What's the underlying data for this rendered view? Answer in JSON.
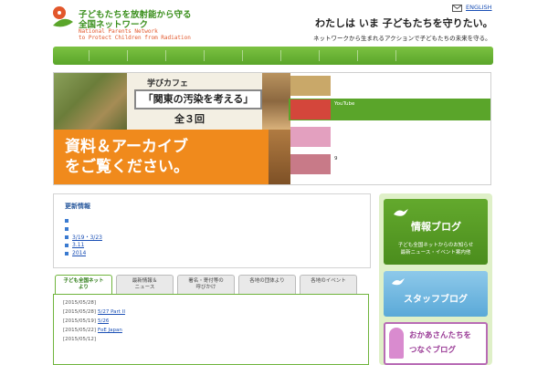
{
  "header": {
    "logo_line1": "子どもたちを放射能から守る",
    "logo_line2": "全国ネットワーク",
    "logo_en1": "National Parents Network",
    "logo_en2": "to Protect Children from Radiation",
    "english_link": "ENGLISH",
    "tagline": "わたしは いま 子どもたちを守りたい。",
    "subtagline": "ネットワークから生まれるアクションで子どもたちの未来を守る。"
  },
  "nav": {
    "items": [
      "",
      "",
      "",
      "",
      "",
      "",
      "",
      "",
      ""
    ]
  },
  "banner": {
    "cafe_title": "学びカフェ",
    "cafe_main": "「関東の汚染を考える」",
    "cafe_round": "全３回",
    "orange_line1": "資料＆アーカイブ",
    "orange_line2": "をご覧ください。",
    "list": [
      {
        "text": "",
        "active": false,
        "thumb": "#c9a869"
      },
      {
        "text": "YouTube",
        "active": true,
        "thumb": "#d4463b"
      },
      {
        "text": "",
        "active": false,
        "thumb": "#e3a0bf"
      },
      {
        "text": "9",
        "active": false,
        "thumb": "#c87a88"
      }
    ]
  },
  "news": {
    "title": "更新情報",
    "items": [
      "",
      "",
      "3/19・3/23",
      "3.11",
      "2014"
    ]
  },
  "tabs": {
    "items": [
      {
        "label": "子ども全国ネット\nより",
        "active": true
      },
      {
        "label": "最新情報＆\nニュース",
        "active": false
      },
      {
        "label": "署名・寄付等の\n呼びかけ",
        "active": false
      },
      {
        "label": "各地の団体より",
        "active": false
      },
      {
        "label": "各地のイベント",
        "active": false
      }
    ],
    "rows": [
      {
        "date": "[2015/05/28]",
        "text": ""
      },
      {
        "date": "[2015/05/28]",
        "text": "5/27 Part II"
      },
      {
        "date": "[2015/05/19]",
        "text": "5/26"
      },
      {
        "date": "[2015/05/22]",
        "text": "FoE Japan"
      },
      {
        "date": "[2015/05/12]",
        "text": ""
      }
    ]
  },
  "sidebar": {
    "info_title": "情報ブログ",
    "info_sub1": "子ども全国ネットからのお知らせ",
    "info_sub2": "最新ニュース・イベント案内他",
    "staff_title": "スタッフブログ",
    "mom_line1": "おかあさんたちを",
    "mom_line2": "つなぐブログ"
  },
  "colors": {
    "brand_green": "#5aa52a",
    "accent_orange": "#f08a1c",
    "link_blue": "#1a4fb5"
  },
  "icons": {
    "logo": "bird-leaf-icon",
    "mail": "mail-icon"
  }
}
